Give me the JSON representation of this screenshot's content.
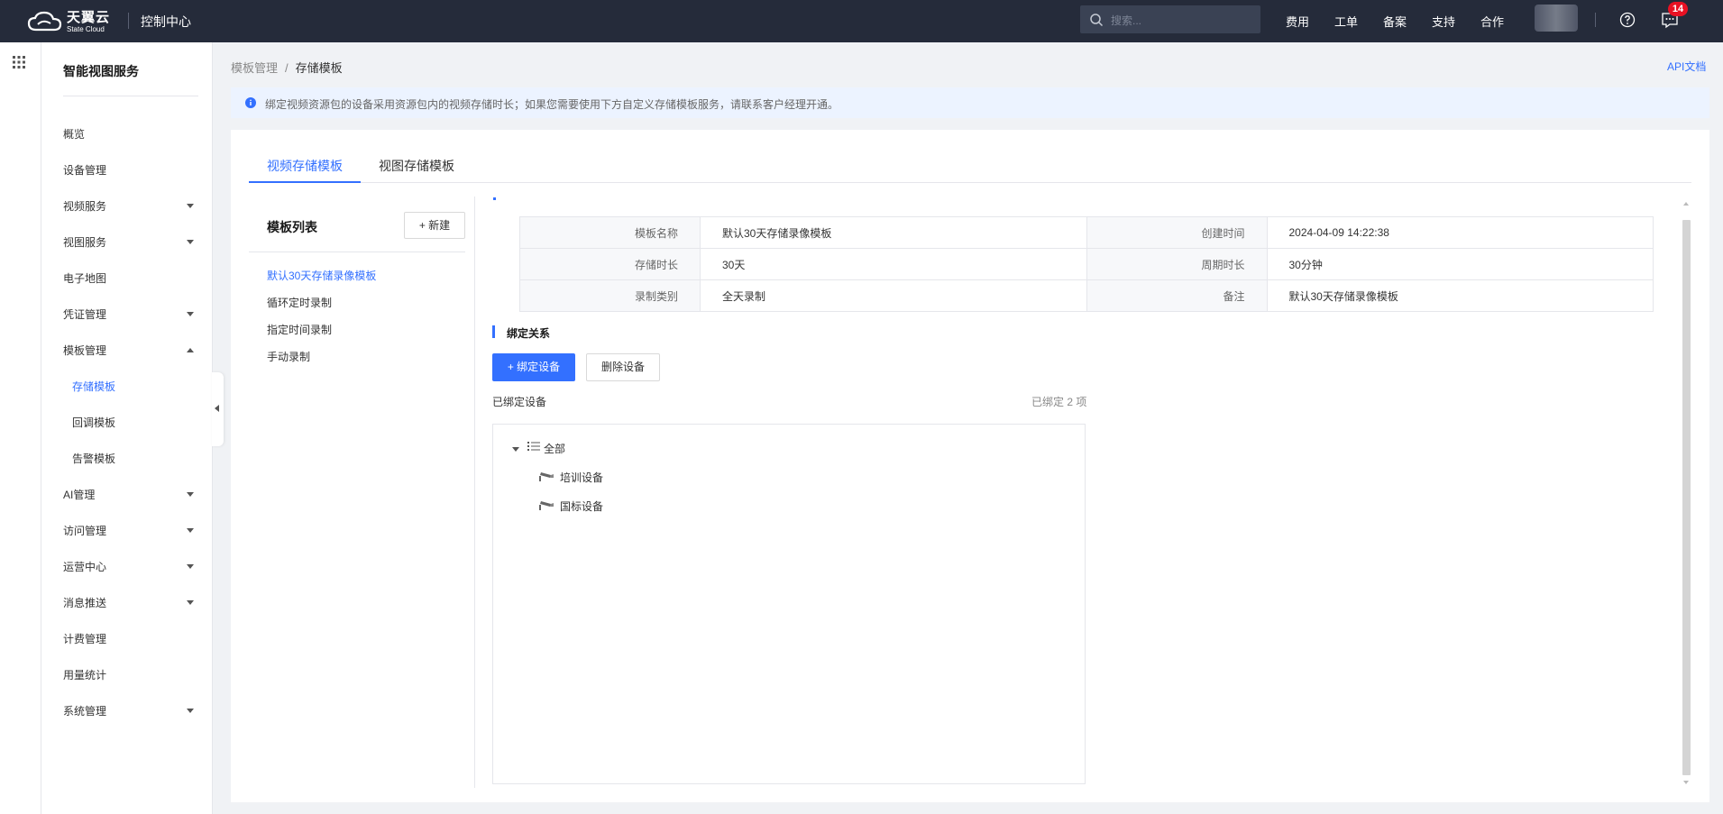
{
  "topbar": {
    "logo_cn": "天翼云",
    "logo_en": "State Cloud",
    "console_title": "控制中心",
    "search_placeholder": "搜索...",
    "nav": [
      "费用",
      "工单",
      "备案",
      "支持",
      "合作"
    ],
    "message_count": "14"
  },
  "sidebar": {
    "title": "智能视图服务",
    "items": [
      {
        "label": "概览"
      },
      {
        "label": "设备管理"
      },
      {
        "label": "视频服务"
      },
      {
        "label": "视图服务"
      },
      {
        "label": "电子地图"
      },
      {
        "label": "凭证管理"
      },
      {
        "label": "模板管理"
      },
      {
        "label": "存储模板"
      },
      {
        "label": "回调模板"
      },
      {
        "label": "告警模板"
      },
      {
        "label": "AI管理"
      },
      {
        "label": "访问管理"
      },
      {
        "label": "运营中心"
      },
      {
        "label": "消息推送"
      },
      {
        "label": "计费管理"
      },
      {
        "label": "用量统计"
      },
      {
        "label": "系统管理"
      }
    ]
  },
  "breadcrumb": {
    "parent": "模板管理",
    "separator": "/",
    "current": "存储模板"
  },
  "api_doc": "API文档",
  "notice": "绑定视频资源包的设备采用资源包内的视频存储时长；如果您需要使用下方自定义存储模板服务，请联系客户经理开通。",
  "tabs": [
    "视频存储模板",
    "视图存储模板"
  ],
  "template_list": {
    "title": "模板列表",
    "new_button": "+ 新建",
    "items": [
      "默认30天存储录像模板",
      "循环定时录制",
      "指定时间录制",
      "手动录制"
    ]
  },
  "detail": {
    "rows": [
      {
        "k1": "模板名称",
        "v1": "默认30天存储录像模板",
        "k2": "创建时间",
        "v2": "2024-04-09 14:22:38"
      },
      {
        "k1": "存储时长",
        "v1": "30天",
        "k2": "周期时长",
        "v2": "30分钟"
      },
      {
        "k1": "录制类别",
        "v1": "全天录制",
        "k2": "备注",
        "v2": "默认30天存储录像模板"
      }
    ]
  },
  "binding": {
    "section_title": "绑定关系",
    "bind_button": "+ 绑定设备",
    "unbind_button": "删除设备",
    "bound_label": "已绑定设备",
    "bound_count": "已绑定 2 项",
    "tree_root": "全部",
    "devices": [
      "培训设备",
      "国标设备"
    ]
  },
  "colors": {
    "accent": "#3370ff",
    "topbar": "#252b3a",
    "badge": "#e81123"
  }
}
